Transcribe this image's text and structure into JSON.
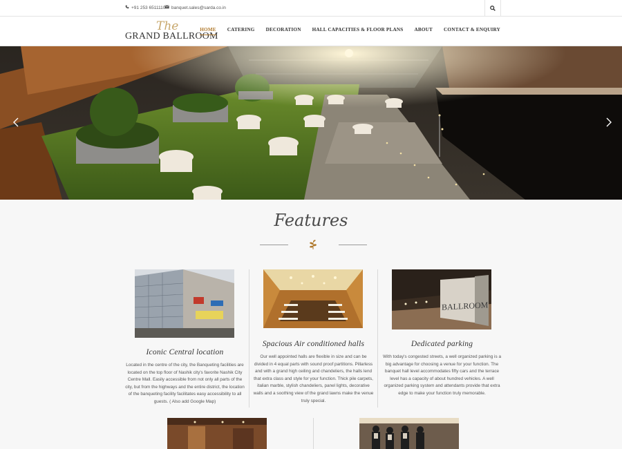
{
  "topbar": {
    "phone": "+91 253 6511110",
    "email": "banquet.sales@sarda.co.in",
    "phone_icon": "phone-icon",
    "email_icon": "envelope-icon",
    "search_icon": "search-icon"
  },
  "logo": {
    "script": "The",
    "wordmark": "GRAND BALLROOM"
  },
  "nav": {
    "items": [
      "HOME",
      "CATERING",
      "DECORATION",
      "HALL CAPACITIES & FLOOR PLANS",
      "ABOUT",
      "CONTACT & ENQUIRY"
    ],
    "active": "HOME"
  },
  "hero": {
    "prev_icon": "chevron-left-icon",
    "next_icon": "chevron-right-icon"
  },
  "features": {
    "title": "Features",
    "ornament_icon": "leaf-icon",
    "cards": [
      {
        "title": "Iconic Central location",
        "text": "Located in the centre of the city, the Banqueting facilities are located on the top floor of Nashik city's favorite Nashik City Centre Mall. Easily accessible from not only all parts of the city, but from the highways and the entire district, the location of the banqueting facility facilitates easy accessibility to all guests. ( Also add Google Map)"
      },
      {
        "title": "Spacious Air conditioned halls",
        "text": "Our well appointed halls are flexible in size and can be divided in 4 equal parts with sound proof partitions. Pillarless and with a grand high ceiling and chandeliers, the halls lend that extra class and style for your function. Thick pile carpets, italian marble, stylish chandeliers, panel lights, decorative walls and a soothing view of the grand lawns make the venue truly special."
      },
      {
        "title": "Dedicated parking",
        "text": "With today's congested streets, a well organized parking is a big advantage for choosing a venue for your function. The banquet hall level accommodates fifty cars and the terrace level has a capacity of about hundred vehicles. A well organized parking system and attendants provide that extra edge to make your function truly memorable."
      }
    ],
    "sign_text": "BALLROOM"
  },
  "colors": {
    "accent": "#b07a2e",
    "grass": "#4a6b1e",
    "hero_dark": "#1b1712"
  }
}
